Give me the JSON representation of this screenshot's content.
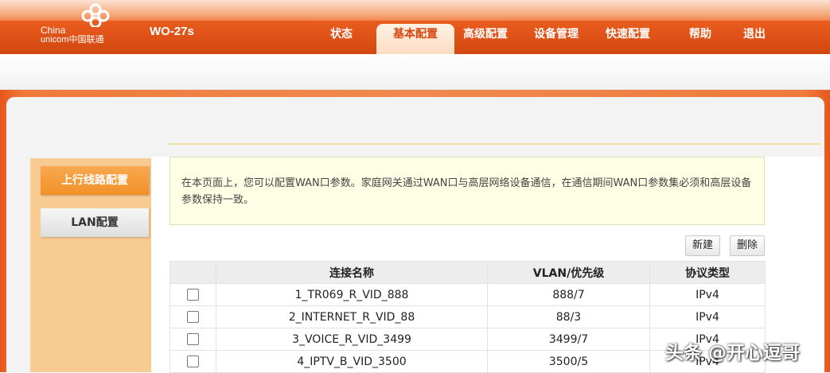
{
  "brand": {
    "logo_line1": "China",
    "logo_line2": "unicom中国联通",
    "device_name": "WO-27s"
  },
  "nav": {
    "items": [
      {
        "label": "状态",
        "active": false
      },
      {
        "label": "基本配置",
        "active": true
      },
      {
        "label": "高级配置",
        "active": false
      },
      {
        "label": "设备管理",
        "active": false
      },
      {
        "label": "快速配置",
        "active": false
      },
      {
        "label": "帮助",
        "active": false
      },
      {
        "label": "退出",
        "active": false
      }
    ]
  },
  "sidebar": {
    "items": [
      {
        "label": "上行线路配置",
        "active": true
      },
      {
        "label": "LAN配置",
        "active": false
      }
    ]
  },
  "info_text": "在本页面上，您可以配置WAN口参数。家庭网关通过WAN口与高层网络设备通信，在通信期间WAN口参数集必须和高层设备参数保持一致。",
  "toolbar": {
    "new_label": "新建",
    "delete_label": "删除"
  },
  "table": {
    "headers": [
      "",
      "连接名称",
      "VLAN/优先级",
      "协议类型"
    ],
    "rows": [
      {
        "name": "1_TR069_R_VID_888",
        "vlan": "888/7",
        "protocol": "IPv4",
        "checked": false
      },
      {
        "name": "2_INTERNET_R_VID_88",
        "vlan": "88/3",
        "protocol": "IPv4",
        "checked": false
      },
      {
        "name": "3_VOICE_R_VID_3499",
        "vlan": "3499/7",
        "protocol": "IPv4",
        "checked": false
      },
      {
        "name": "4_IPTV_B_VID_3500",
        "vlan": "3500/5",
        "protocol": "IPv4",
        "checked": false
      }
    ]
  },
  "watermark": "头条 @开心逗哥",
  "colors": {
    "header_orange": "#e4561a",
    "active_tab_text": "#d4470f",
    "sidebar_bg": "#f8cb93",
    "sidebar_active": "#f29128",
    "info_bg": "#ffffe5",
    "table_header_bg": "#ededed"
  }
}
